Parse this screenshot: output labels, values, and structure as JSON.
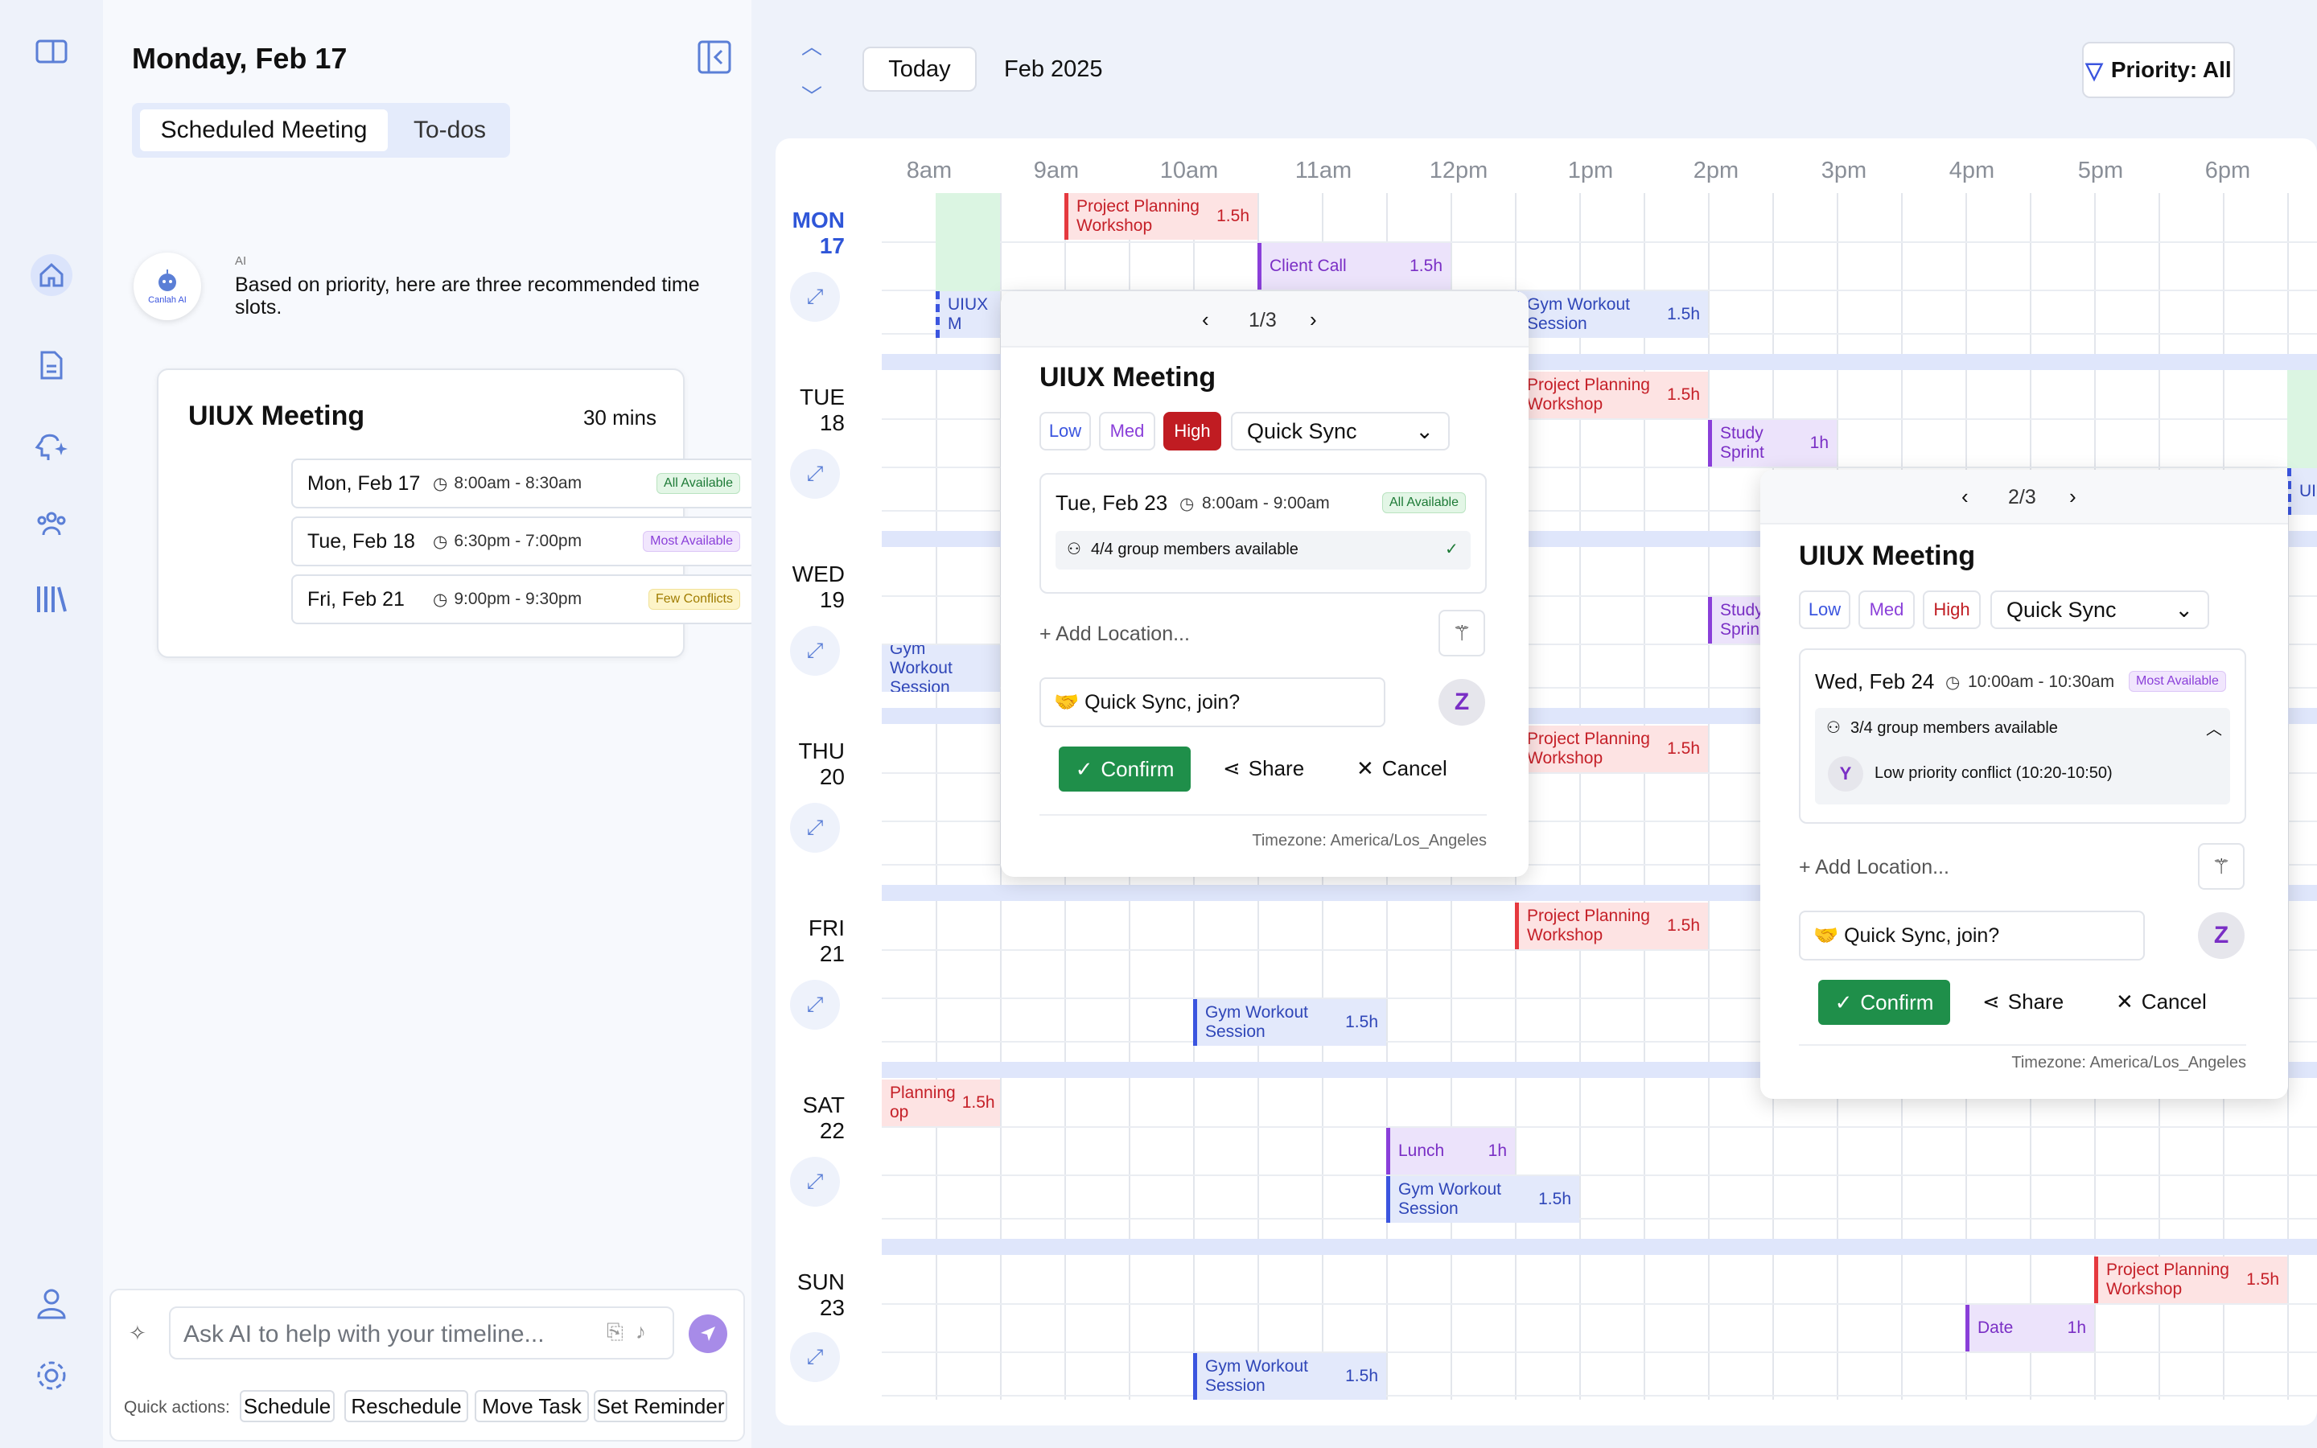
{
  "panel": {
    "date_title": "Monday, Feb 17",
    "tabs": [
      "Scheduled Meeting",
      "To-dos"
    ],
    "ai": {
      "tag": "AI",
      "avatar_label": "Canlah AI",
      "message": "Based on priority, here are three recommended time slots."
    },
    "card": {
      "title": "UIUX Meeting",
      "duration": "30 mins",
      "slots": [
        {
          "date": "Mon, Feb 17",
          "time": "8:00am - 8:30am",
          "badge": "All Available"
        },
        {
          "date": "Tue, Feb 18",
          "time": "6:30pm - 7:00pm",
          "badge": "Most Available"
        },
        {
          "date": "Fri, Feb 21",
          "time": "9:00pm - 9:30pm",
          "badge": "Few Conflicts"
        }
      ]
    },
    "chat": {
      "placeholder": "Ask AI to help with your timeline...",
      "quick_label": "Quick actions:",
      "quick_actions": [
        "Schedule",
        "Reschedule",
        "Move Task",
        "Set Reminder"
      ]
    }
  },
  "toolbar": {
    "today": "Today",
    "month": "Feb 2025",
    "filter": "Priority: All"
  },
  "times": [
    "8am",
    "9am",
    "10am",
    "11am",
    "12pm",
    "1pm",
    "2pm",
    "3pm",
    "4pm",
    "5pm",
    "6pm"
  ],
  "days": [
    {
      "dow": "MON",
      "num": "17"
    },
    {
      "dow": "TUE",
      "num": "18"
    },
    {
      "dow": "WED",
      "num": "19"
    },
    {
      "dow": "THU",
      "num": "20"
    },
    {
      "dow": "FRI",
      "num": "21"
    },
    {
      "dow": "SAT",
      "num": "22"
    },
    {
      "dow": "SUN",
      "num": "23"
    }
  ],
  "events": {
    "mon_ppw": {
      "name": "Project Planning Workshop",
      "dur": "1.5h"
    },
    "mon_cc": {
      "name": "Client Call",
      "dur": "1.5h"
    },
    "mon_uiux": {
      "name": "UIUX M"
    },
    "mon_gym": {
      "name": "Gym Workout Session",
      "dur": "1.5h"
    },
    "tue_ppw": {
      "name": "Project Planning Workshop",
      "dur": "1.5h"
    },
    "tue_study": {
      "name": "Study Sprint",
      "dur": "1h"
    },
    "tue_ui": {
      "name": "UI"
    },
    "wed_gym": {
      "name": "Gym Workout Session"
    },
    "wed_study": {
      "name": "Study Sprin"
    },
    "thu_ppw": {
      "name": "Project Planning Workshop",
      "dur": "1.5h"
    },
    "fri_ppw": {
      "name": "Project Planning Workshop",
      "dur": "1.5h"
    },
    "fri_gym": {
      "name": "Gym Workout Session",
      "dur": "1.5h"
    },
    "sat_ppw": {
      "name": "Planning op",
      "dur": "1.5h"
    },
    "sat_lunch": {
      "name": "Lunch",
      "dur": "1h"
    },
    "sat_gym": {
      "name": "Gym Workout Session",
      "dur": "1.5h"
    },
    "sun_ppw": {
      "name": "Project Planning Workshop",
      "dur": "1.5h"
    },
    "sun_date": {
      "name": "Date",
      "dur": "1h"
    },
    "sun_gym": {
      "name": "Gym Workout Session",
      "dur": "1.5h"
    }
  },
  "popup1": {
    "pager": "1/3",
    "title": "UIUX Meeting",
    "priorities": [
      "Low",
      "Med",
      "High"
    ],
    "type": "Quick Sync",
    "date": "Tue, Feb 23",
    "time": "8:00am - 9:00am",
    "badge": "All Available",
    "members": "4/4 group members available",
    "location": "+ Add Location...",
    "message": "🤝 Quick Sync, join?",
    "avatar": "Z",
    "confirm": "Confirm",
    "share": "Share",
    "cancel": "Cancel",
    "timezone": "Timezone: America/Los_Angeles"
  },
  "popup2": {
    "pager": "2/3",
    "title": "UIUX Meeting",
    "priorities": [
      "Low",
      "Med",
      "High"
    ],
    "type": "Quick Sync",
    "date": "Wed, Feb 24",
    "time": "10:00am - 10:30am",
    "badge": "Most Available",
    "members": "3/4 group members available",
    "conflict_avatar": "Y",
    "conflict": "Low priority conflict (10:20-10:50)",
    "location": "+ Add Location...",
    "message": "🤝 Quick Sync, join?",
    "avatar": "Z",
    "confirm": "Confirm",
    "share": "Share",
    "cancel": "Cancel",
    "timezone": "Timezone: America/Los_Angeles"
  },
  "colors": {
    "high": "#c01c22",
    "confirm": "#1f8f4a",
    "accent": "#3b55df"
  }
}
